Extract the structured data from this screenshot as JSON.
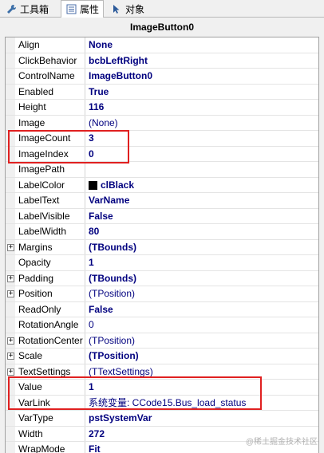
{
  "tabs": [
    {
      "label": "工具箱",
      "icon": "wrench-icon"
    },
    {
      "label": "属性",
      "icon": "properties-icon",
      "active": true
    },
    {
      "label": "对象",
      "icon": "cursor-icon"
    }
  ],
  "title": "ImageButton0",
  "properties": [
    {
      "name": "Align",
      "value": "None",
      "style": "bold"
    },
    {
      "name": "ClickBehavior",
      "value": "bcbLeftRight",
      "style": "bold"
    },
    {
      "name": "ControlName",
      "value": "ImageButton0",
      "style": "bold"
    },
    {
      "name": "Enabled",
      "value": "True",
      "style": "bold"
    },
    {
      "name": "Height",
      "value": "116",
      "style": "bold"
    },
    {
      "name": "Image",
      "value": "(None)",
      "style": "plain"
    },
    {
      "name": "ImageCount",
      "value": "3",
      "style": "bold"
    },
    {
      "name": "ImageIndex",
      "value": "0",
      "style": "bold"
    },
    {
      "name": "ImagePath",
      "value": "",
      "style": "plain"
    },
    {
      "name": "LabelColor",
      "value": "clBlack",
      "style": "bold",
      "swatch": "#000000"
    },
    {
      "name": "LabelText",
      "value": "VarName",
      "style": "bold"
    },
    {
      "name": "LabelVisible",
      "value": "False",
      "style": "bold"
    },
    {
      "name": "LabelWidth",
      "value": "80",
      "style": "bold"
    },
    {
      "name": "Margins",
      "value": "(TBounds)",
      "style": "bold",
      "expandable": true
    },
    {
      "name": "Opacity",
      "value": "1",
      "style": "bold"
    },
    {
      "name": "Padding",
      "value": "(TBounds)",
      "style": "bold",
      "expandable": true
    },
    {
      "name": "Position",
      "value": "(TPosition)",
      "style": "plain",
      "expandable": true
    },
    {
      "name": "ReadOnly",
      "value": "False",
      "style": "bold"
    },
    {
      "name": "RotationAngle",
      "value": "0",
      "style": "plain"
    },
    {
      "name": "RotationCenter",
      "value": "(TPosition)",
      "style": "plain",
      "expandable": true
    },
    {
      "name": "Scale",
      "value": "(TPosition)",
      "style": "bold",
      "expandable": true
    },
    {
      "name": "TextSettings",
      "value": "(TTextSettings)",
      "style": "plain",
      "expandable": true
    },
    {
      "name": "Value",
      "value": "1",
      "style": "bold"
    },
    {
      "name": "VarLink",
      "value": "系统变量: CCode15.Bus_load_status",
      "style": "plain"
    },
    {
      "name": "VarType",
      "value": "pstSystemVar",
      "style": "bold"
    },
    {
      "name": "Width",
      "value": "272",
      "style": "bold"
    },
    {
      "name": "WrapMode",
      "value": "Fit",
      "style": "bold"
    }
  ],
  "watermark": "@稀土掘金技术社区",
  "colors": {
    "highlight": "#e02020",
    "value_text": "#00007f"
  }
}
